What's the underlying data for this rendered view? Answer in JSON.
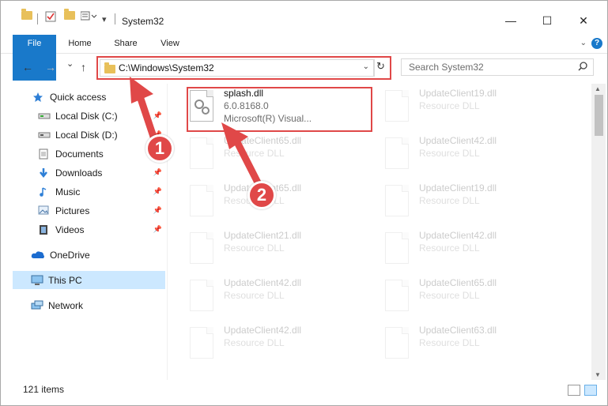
{
  "window": {
    "title": "System32",
    "controls": {
      "minimize": "—",
      "maximize": "☐",
      "close": "✕"
    }
  },
  "ribbon": {
    "tabs": [
      "File",
      "Home",
      "Share",
      "View"
    ]
  },
  "nav": {
    "back": "←",
    "forward": "→",
    "recent": "⌄",
    "up": "↑"
  },
  "address": {
    "path": "C:\\Windows\\System32",
    "dropdown": "⌄",
    "refresh": "↻"
  },
  "search": {
    "placeholder": "Search System32",
    "icon": "⚲"
  },
  "sidebar": {
    "items": [
      {
        "label": "Quick access",
        "icon": "star-icon",
        "color": "#2e7fd6"
      },
      {
        "label": "Local Disk (C:)",
        "icon": "drive-icon",
        "pinned": true
      },
      {
        "label": "Local Disk (D:)",
        "icon": "drive-icon",
        "pinned": true
      },
      {
        "label": "Documents",
        "icon": "documents-icon",
        "pinned": true
      },
      {
        "label": "Downloads",
        "icon": "downloads-icon",
        "pinned": true
      },
      {
        "label": "Music",
        "icon": "music-icon",
        "pinned": true
      },
      {
        "label": "Pictures",
        "icon": "pictures-icon",
        "pinned": true
      },
      {
        "label": "Videos",
        "icon": "videos-icon",
        "pinned": true
      },
      {
        "label": "OneDrive",
        "icon": "cloud-icon"
      },
      {
        "label": "This PC",
        "icon": "computer-icon",
        "selected": true
      },
      {
        "label": "Network",
        "icon": "network-icon"
      }
    ]
  },
  "files": [
    {
      "name": "splash.dll",
      "line2": "6.0.8168.0",
      "line3": "Microsoft(R) Visual...",
      "highlighted": true
    },
    {
      "name": "UpdateClient19.dll",
      "line2": "Resource DLL"
    },
    {
      "name": "UpdateClient65.dll",
      "line2": "Resource DLL"
    },
    {
      "name": "UpdateClient42.dll",
      "line2": "Resource DLL"
    },
    {
      "name": "UpdateClient65.dll",
      "line2": "Resource DLL"
    },
    {
      "name": "UpdateClient19.dll",
      "line2": "Resource DLL"
    },
    {
      "name": "UpdateClient21.dll",
      "line2": "Resource DLL"
    },
    {
      "name": "UpdateClient42.dll",
      "line2": "Resource DLL"
    },
    {
      "name": "UpdateClient42.dll",
      "line2": "Resource DLL"
    },
    {
      "name": "UpdateClient65.dll",
      "line2": "Resource DLL"
    },
    {
      "name": "UpdateClient42.dll",
      "line2": "Resource DLL"
    },
    {
      "name": "UpdateClient63.dll",
      "line2": "Resource DLL"
    }
  ],
  "annotations": {
    "step1": "1",
    "step2": "2",
    "color": "#e04848"
  },
  "status": {
    "item_count": "121 items"
  }
}
